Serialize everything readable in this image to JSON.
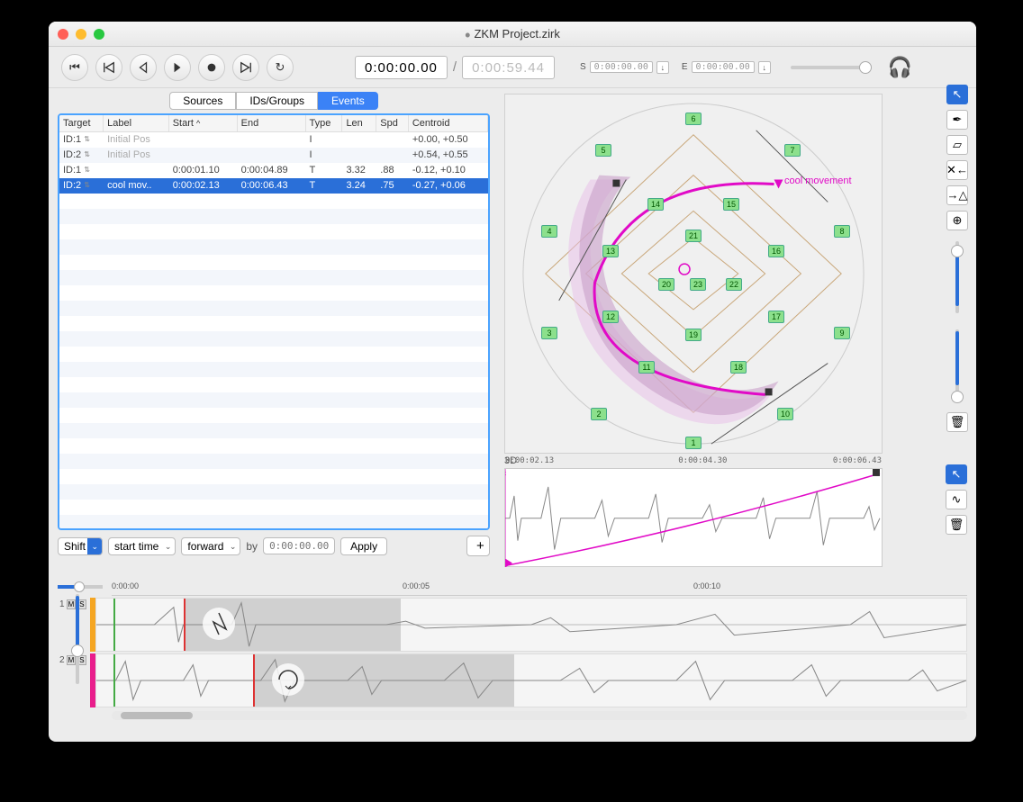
{
  "window": {
    "title": "ZKM Project.zirk",
    "modified": true
  },
  "transport": {
    "current": "0:00:00.00",
    "total": "0:00:59.44",
    "start_label": "S",
    "start_val": "0:00:00.00",
    "end_label": "E",
    "end_val": "0:00:00.00"
  },
  "tabs": {
    "sources": "Sources",
    "ids": "IDs/Groups",
    "events": "Events",
    "active": "events"
  },
  "table": {
    "headers": {
      "target": "Target",
      "label": "Label",
      "start": "Start",
      "end": "End",
      "type": "Type",
      "len": "Len",
      "spd": "Spd",
      "centroid": "Centroid"
    },
    "sort_arrow": "^",
    "rows": [
      {
        "target": "ID:1",
        "label": "Initial Pos",
        "start": "",
        "end": "",
        "type": "I",
        "len": "",
        "spd": "",
        "centroid": "+0.00, +0.50",
        "grey": true
      },
      {
        "target": "ID:2",
        "label": "Initial Pos",
        "start": "",
        "end": "",
        "type": "I",
        "len": "",
        "spd": "",
        "centroid": "+0.54, +0.55",
        "grey": true
      },
      {
        "target": "ID:1",
        "label": "",
        "start": "0:00:01.10",
        "end": "0:00:04.89",
        "type": "T",
        "len": "3.32",
        "spd": ".88",
        "centroid": "-0.12, +0.10"
      },
      {
        "target": "ID:2",
        "label": "cool mov..",
        "start": "0:00:02.13",
        "end": "0:00:06.43",
        "type": "T",
        "len": "3.24",
        "spd": ".75",
        "centroid": "-0.27, +0.06",
        "selected": true
      }
    ]
  },
  "shiftbar": {
    "shift": "Shift",
    "starttime": "start time",
    "forward": "forward",
    "by": "by",
    "placeholder": "0:00:00.00",
    "apply": "Apply",
    "plus": "+"
  },
  "spatial": {
    "label_3d": "3D",
    "annotation": "cool movement",
    "speakers": [
      1,
      2,
      3,
      4,
      5,
      6,
      7,
      8,
      9,
      10,
      11,
      12,
      13,
      14,
      15,
      16,
      17,
      18,
      19,
      20,
      21,
      22,
      23
    ]
  },
  "detail": {
    "ticks": [
      "0:00:02.13",
      "0:00:04.30",
      "0:00:06.43"
    ]
  },
  "timeline": {
    "ruler": [
      "0:00:00",
      "0:00:05",
      "0:00:10"
    ],
    "tracks": [
      {
        "num": "1",
        "color": "#f5a623"
      },
      {
        "num": "2",
        "color": "#e91e8c"
      }
    ]
  }
}
